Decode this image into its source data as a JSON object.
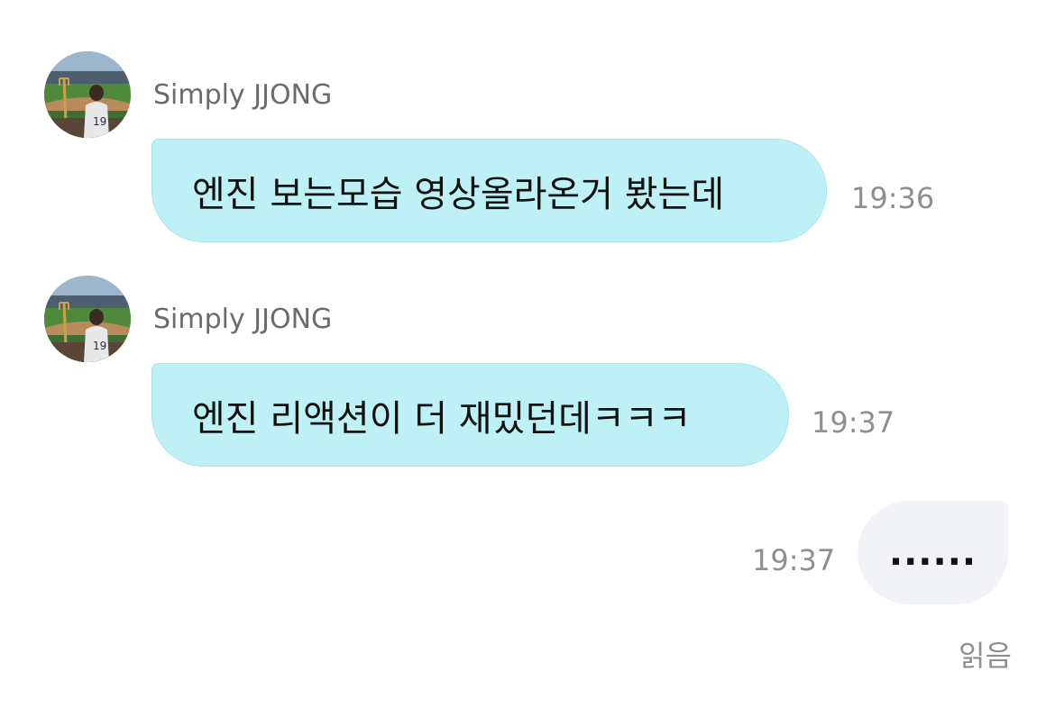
{
  "messages": [
    {
      "sender": "Simply JJONG",
      "text": "엔진 보는모습 영상올라온거 봤는데",
      "time": "19:36",
      "direction": "incoming"
    },
    {
      "sender": "Simply JJONG",
      "text": "엔진 리액션이 더 재밌던데ㅋㅋㅋ",
      "time": "19:37",
      "direction": "incoming"
    },
    {
      "text": "......",
      "time": "19:37",
      "direction": "outgoing"
    }
  ],
  "read_status": "읽음",
  "avatar_icon": "avatar-baseball-stadium-photo",
  "colors": {
    "incoming_bubble": "#bdf1f5",
    "outgoing_bubble": "#f2f3f7",
    "timestamp": "#8e8e93",
    "sender_name": "#6b6b6b"
  }
}
